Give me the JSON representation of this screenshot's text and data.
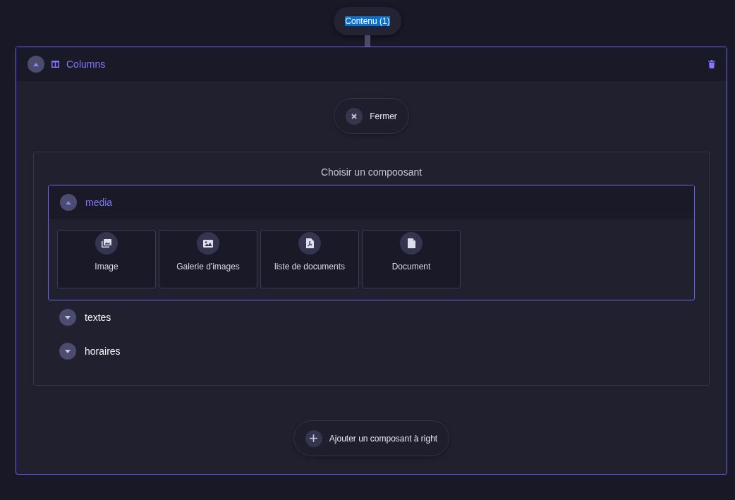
{
  "top_pill": {
    "label": "Contenu (1)",
    "highlighted": true
  },
  "block": {
    "title": "Columns",
    "expanded": true,
    "close_button": {
      "label": "Fermer"
    },
    "picker": {
      "title": "Choisir un compoosant",
      "categories": [
        {
          "label": "media",
          "expanded": true,
          "items": [
            {
              "label": "Image",
              "kind": "images"
            },
            {
              "label": "Galerie d'images",
              "kind": "image"
            },
            {
              "label": "liste de documents",
              "kind": "pdf"
            },
            {
              "label": "Document",
              "kind": "file"
            }
          ]
        },
        {
          "label": "textes",
          "expanded": false
        },
        {
          "label": "horaires",
          "expanded": false
        }
      ]
    },
    "add_button": {
      "label": "Ajouter un composant à right"
    }
  }
}
